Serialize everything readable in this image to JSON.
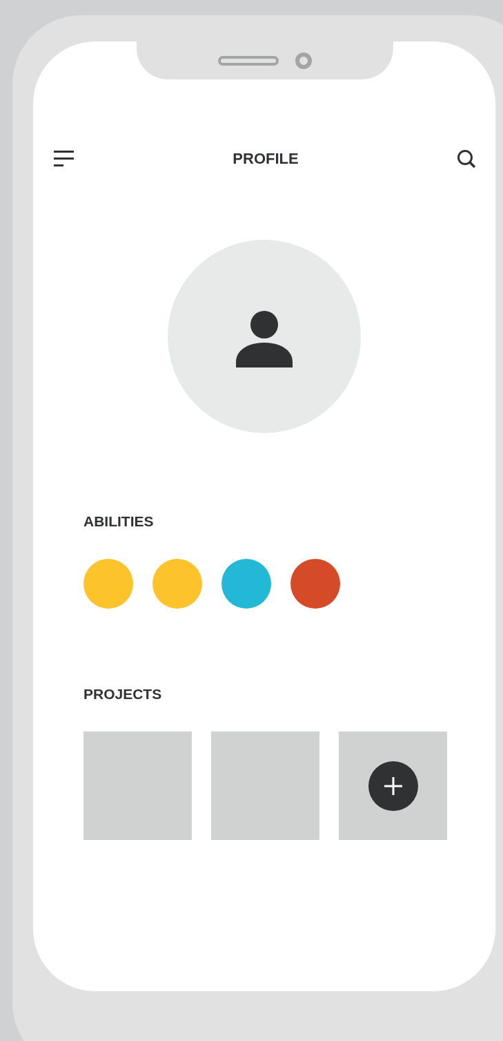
{
  "header": {
    "title": "PROFILE"
  },
  "abilities": {
    "title": "ABILITIES",
    "items": [
      {
        "color": "#fcc42a"
      },
      {
        "color": "#fcc42a"
      },
      {
        "color": "#22b8d6"
      },
      {
        "color": "#d54b28"
      }
    ]
  },
  "projects": {
    "title": "PROJECTS",
    "items": [
      {
        "kind": "empty"
      },
      {
        "kind": "empty"
      },
      {
        "kind": "add"
      }
    ]
  }
}
